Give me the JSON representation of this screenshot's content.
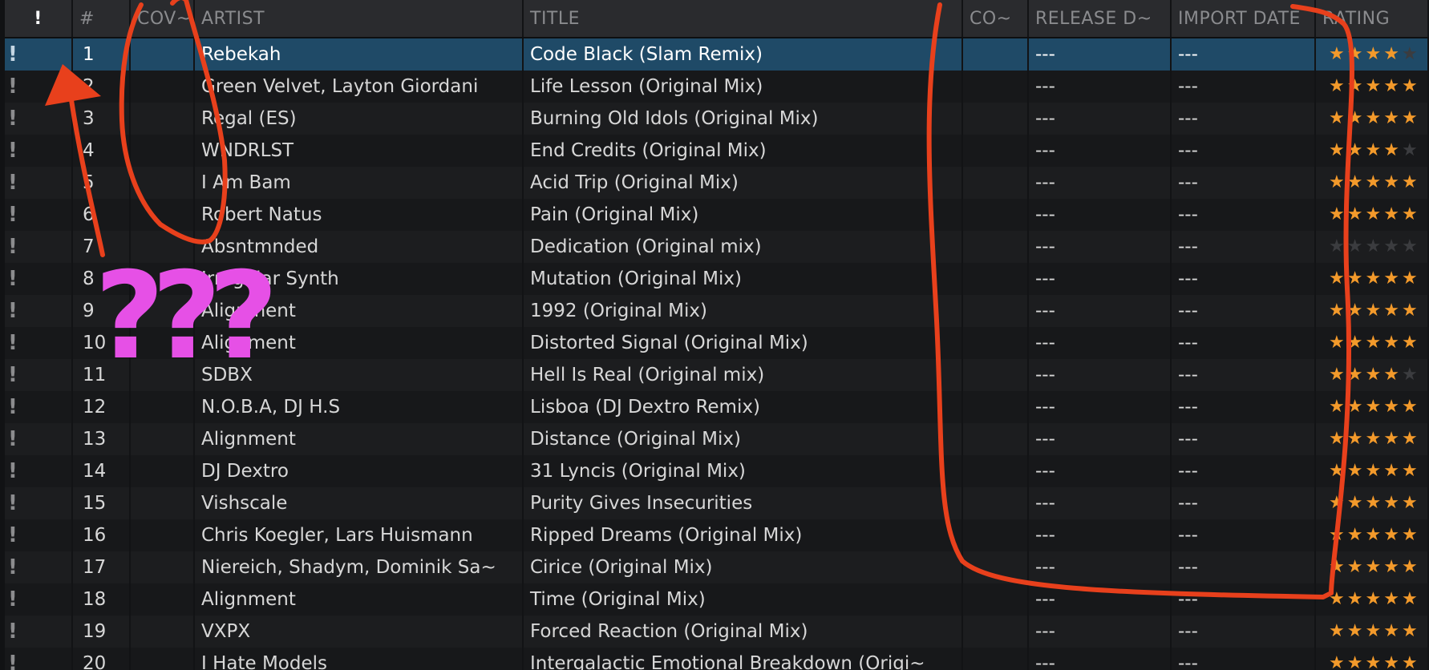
{
  "columns": {
    "flag": "!",
    "num": "#",
    "cover": "COV~",
    "artist": "ARTIST",
    "title": "TITLE",
    "comment": "CO~",
    "release_date": "RELEASE D~",
    "import_date": "IMPORT DATE",
    "rating": "RATING"
  },
  "tracks": [
    {
      "flag": "!",
      "num": "1",
      "artist": "Rebekah",
      "title": "Code Black (Slam Remix)",
      "release": "---",
      "import": "---",
      "rating": 4
    },
    {
      "flag": "!",
      "num": "2",
      "artist": "Green Velvet, Layton Giordani",
      "title": "Life Lesson (Original Mix)",
      "release": "---",
      "import": "---",
      "rating": 5
    },
    {
      "flag": "!",
      "num": "3",
      "artist": "Regal (ES)",
      "title": "Burning Old Idols (Original Mix)",
      "release": "---",
      "import": "---",
      "rating": 5
    },
    {
      "flag": "!",
      "num": "4",
      "artist": "WNDRLST",
      "title": "End Credits (Original Mix)",
      "release": "---",
      "import": "---",
      "rating": 4
    },
    {
      "flag": "!",
      "num": "5",
      "artist": "I Am Bam",
      "title": "Acid Trip (Original Mix)",
      "release": "---",
      "import": "---",
      "rating": 5
    },
    {
      "flag": "!",
      "num": "6",
      "artist": "Robert Natus",
      "title": "Pain (Original Mix)",
      "release": "---",
      "import": "---",
      "rating": 5
    },
    {
      "flag": "!",
      "num": "7",
      "artist": "Absntmnded",
      "title": "Dedication (Original mix)",
      "release": "---",
      "import": "---",
      "rating": 0
    },
    {
      "flag": "!",
      "num": "8",
      "artist": "Irregular Synth",
      "title": "Mutation (Original Mix)",
      "release": "---",
      "import": "---",
      "rating": 5
    },
    {
      "flag": "!",
      "num": "9",
      "artist": "Alignment",
      "title": "1992 (Original Mix)",
      "release": "---",
      "import": "---",
      "rating": 5
    },
    {
      "flag": "!",
      "num": "10",
      "artist": "Alignment",
      "title": "Distorted Signal (Original Mix)",
      "release": "---",
      "import": "---",
      "rating": 5
    },
    {
      "flag": "!",
      "num": "11",
      "artist": "SDBX",
      "title": "Hell Is Real (Original mix)",
      "release": "---",
      "import": "---",
      "rating": 4
    },
    {
      "flag": "!",
      "num": "12",
      "artist": "N.O.B.A, DJ H.S",
      "title": "Lisboa (DJ Dextro Remix)",
      "release": "---",
      "import": "---",
      "rating": 5
    },
    {
      "flag": "!",
      "num": "13",
      "artist": "Alignment",
      "title": "Distance (Original Mix)",
      "release": "---",
      "import": "---",
      "rating": 5
    },
    {
      "flag": "!",
      "num": "14",
      "artist": "DJ Dextro",
      "title": "31 Lyncis (Original Mix)",
      "release": "---",
      "import": "---",
      "rating": 5
    },
    {
      "flag": "!",
      "num": "15",
      "artist": "Vishscale",
      "title": "Purity Gives Insecurities",
      "release": "---",
      "import": "---",
      "rating": 5
    },
    {
      "flag": "!",
      "num": "16",
      "artist": "Chris Koegler, Lars Huismann",
      "title": "Ripped Dreams (Original Mix)",
      "release": "---",
      "import": "---",
      "rating": 5
    },
    {
      "flag": "!",
      "num": "17",
      "artist": "Niereich, Shadym, Dominik Sa~",
      "title": "Cirice (Original Mix)",
      "release": "---",
      "import": "---",
      "rating": 5
    },
    {
      "flag": "!",
      "num": "18",
      "artist": "Alignment",
      "title": "Time (Original Mix)",
      "release": "---",
      "import": "---",
      "rating": 5
    },
    {
      "flag": "!",
      "num": "19",
      "artist": "VXPX",
      "title": "Forced Reaction (Original Mix)",
      "release": "---",
      "import": "---",
      "rating": 5
    },
    {
      "flag": "!",
      "num": "20",
      "artist": "I Hate Models",
      "title": "Intergalactic Emotional Breakdown (Origi~",
      "release": "---",
      "import": "---",
      "rating": 5
    }
  ],
  "selected_row": 0,
  "annotation": {
    "question_marks": "???",
    "marker_color": "#e8401c",
    "question_color": "#e650e6"
  },
  "colors": {
    "selection": "#1f4a67",
    "star_on": "#f39a2b",
    "star_off": "#3b3c3f"
  }
}
